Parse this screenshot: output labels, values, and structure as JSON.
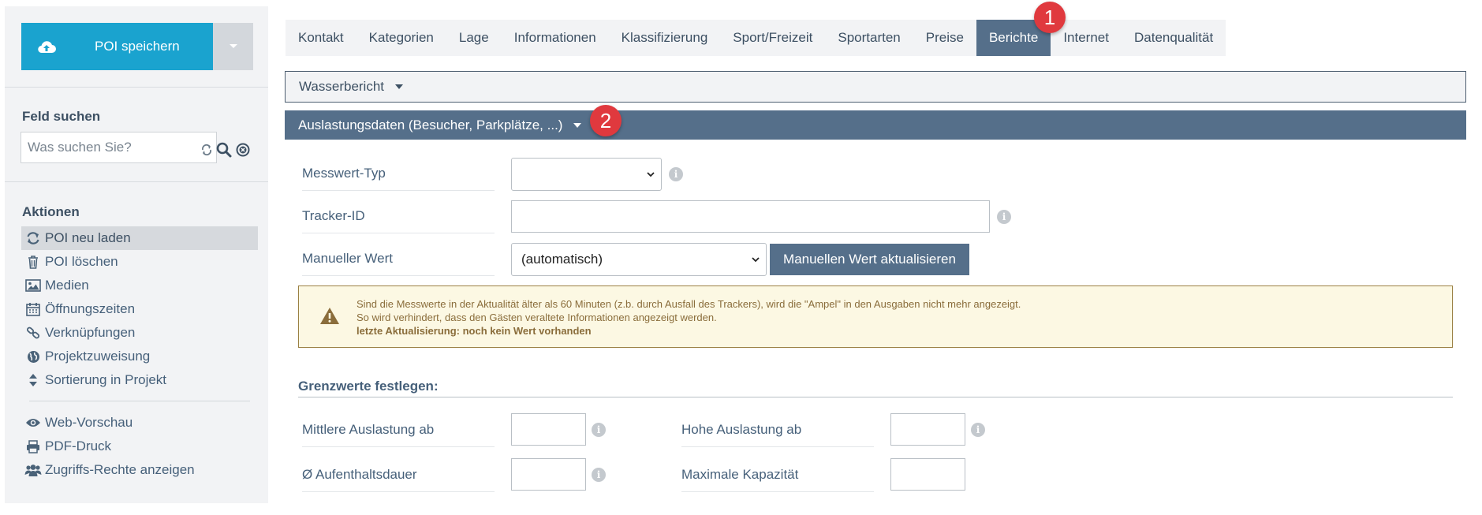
{
  "sidebar": {
    "save_label": "POI speichern",
    "search_heading": "Feld suchen",
    "search_placeholder": "Was suchen Sie?",
    "actions_heading": "Aktionen",
    "actions": [
      {
        "label": "POI neu laden",
        "icon": "refresh-icon",
        "active": true
      },
      {
        "label": "POI löschen",
        "icon": "trash-icon"
      },
      {
        "label": "Medien",
        "icon": "image-icon"
      },
      {
        "label": "Öffnungszeiten",
        "icon": "calendar-icon"
      },
      {
        "label": "Verknüpfungen",
        "icon": "link-icon"
      },
      {
        "label": "Projektzuweisung",
        "icon": "globe-icon"
      },
      {
        "label": "Sortierung in Projekt",
        "icon": "sort-icon"
      }
    ],
    "extra_actions": [
      {
        "label": "Web-Vorschau",
        "icon": "eye-icon"
      },
      {
        "label": "PDF-Druck",
        "icon": "print-icon"
      },
      {
        "label": "Zugriffs-Rechte anzeigen",
        "icon": "users-icon"
      }
    ]
  },
  "tabs": [
    {
      "label": "Kontakt"
    },
    {
      "label": "Kategorien"
    },
    {
      "label": "Lage"
    },
    {
      "label": "Informationen"
    },
    {
      "label": "Klassifizierung"
    },
    {
      "label": "Sport/Freizeit"
    },
    {
      "label": "Sportarten"
    },
    {
      "label": "Preise"
    },
    {
      "label": "Berichte",
      "active": true
    },
    {
      "label": "Internet"
    },
    {
      "label": "Datenqualität"
    }
  ],
  "badges": [
    "1",
    "2"
  ],
  "accordion": {
    "water_report": "Wasserbericht",
    "occupancy": "Auslastungsdaten (Besucher, Parkplätze, ...)"
  },
  "form": {
    "measure_type_label": "Messwert-Typ",
    "measure_type_value": "",
    "tracker_label": "Tracker-ID",
    "tracker_value": "",
    "manual_label": "Manueller Wert",
    "manual_value": "(automatisch)",
    "manual_button": "Manuellen Wert aktualisieren"
  },
  "warning": {
    "line1": "Sind die Messwerte in der Aktualität älter als 60 Minuten (z.b. durch Ausfall des Trackers), wird die \"Ampel\" in den Ausgaben nicht mehr angezeigt.",
    "line2": "So wird verhindert, dass den Gästen veraltete Informationen angezeigt werden.",
    "line3": "letzte Aktualisierung: noch kein Wert vorhanden"
  },
  "thresholds": {
    "heading": "Grenzwerte festlegen:",
    "medium_label": "Mittlere Auslastung ab",
    "high_label": "Hohe Auslastung ab",
    "duration_label": "Ø Aufenthaltsdauer",
    "capacity_label": "Maximale Kapazität"
  },
  "colors": {
    "accent": "#1aa3cf",
    "slate": "#556f8a",
    "badge": "#e0393e",
    "warning_bg": "#fcf8e3"
  }
}
